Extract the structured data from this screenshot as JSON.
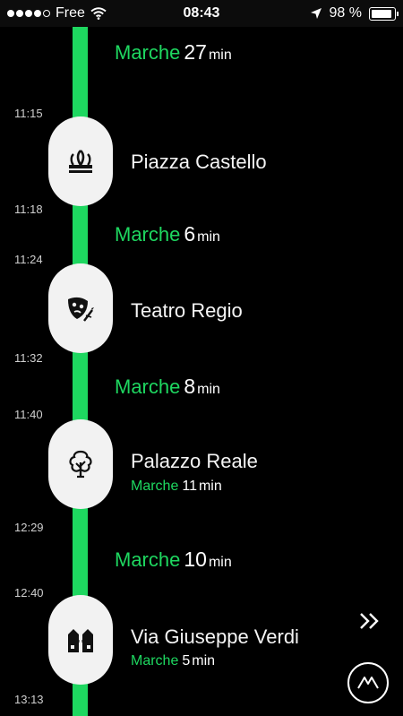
{
  "status_bar": {
    "signal_dots_filled": 4,
    "signal_dots_total": 5,
    "carrier": "Free",
    "time": "08:43",
    "battery": "98 %",
    "battery_level": 0.98
  },
  "colors": {
    "accent": "#1ed760",
    "badge": "#f2f2f2",
    "background": "#000000"
  },
  "timeline": {
    "first_walk": {
      "label": "Marche",
      "minutes": "27",
      "unit": "min"
    },
    "stops": [
      {
        "arrive": "11:15",
        "depart": "11:18",
        "name": "Piazza Castello",
        "icon": "fountain-icon",
        "walk_after": {
          "label": "Marche",
          "minutes": "6",
          "unit": "min"
        }
      },
      {
        "arrive": "11:24",
        "depart": "11:32",
        "name": "Teatro Regio",
        "icon": "theater-mask-icon",
        "walk_after": {
          "label": "Marche",
          "minutes": "8",
          "unit": "min"
        }
      },
      {
        "arrive": "11:40",
        "depart": "12:29",
        "name": "Palazzo Reale",
        "icon": "tree-icon",
        "sub": {
          "label": "Marche",
          "minutes": "11",
          "unit": "min"
        },
        "walk_after": {
          "label": "Marche",
          "minutes": "10",
          "unit": "min"
        }
      },
      {
        "arrive": "12:40",
        "depart": "13:13",
        "name": "Via Giuseppe Verdi",
        "icon": "buildings-icon",
        "sub": {
          "label": "Marche",
          "minutes": "5",
          "unit": "min"
        }
      }
    ]
  },
  "controls": {
    "next_icon": "double-chevron-right-icon",
    "logo_icon": "m-logo-icon"
  }
}
